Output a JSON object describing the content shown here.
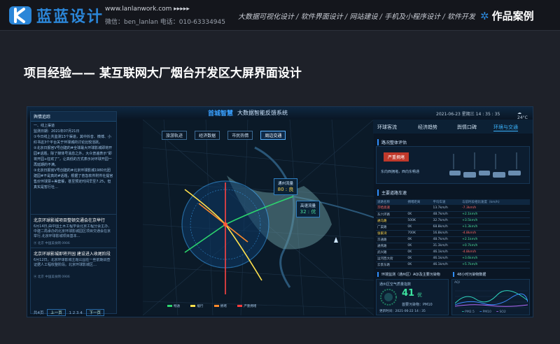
{
  "header": {
    "brand_name": "蓝蓝设计",
    "website": "www.lanlanwork.com  ▸▸▸▸▸",
    "contact": "微信：ben_lanlan    电话：010-63334945",
    "services": "大数据可视化设计 / 软件界面设计 / 网站建设 / 手机及小程序设计 / 软件开发",
    "works_label": "作品案例",
    "brand_color": "#2b86d8"
  },
  "page": {
    "heading": "项目经验—— 某互联网大厂烟台开发区大屏界面设计"
  },
  "screen": {
    "logo_text": "首城智慧",
    "title": "大数据智能反馈系统",
    "date": "2021-06-23  星期三    14 : 35 : 35",
    "temperature": "24°C",
    "left_panel": {
      "header": "舆情追踪",
      "body": "一、线上渠道\n监测日期：2021年07月21日\n①今日线上共监测13个渠道，其中抖音、微博、小红书这3个平台关于环球城的讨论比较活跃。\n②北京日报官V号创建的#全球最大环球影城即将开园#话题，除了媒体号消息之外，大众普遍表示“即将开园+狂欢了”，让高低的方式表示对环球开园一再延期的不满。\n③北京日报官V号创建的#北京环球影城1980元团建园#不是真的#话题，根据了普急软件附件社提官售价环球票+美套餐，甚至预定时间早至7.25，但真实是暂行社…",
      "news": [
        {
          "title": "北京环球影城项目整顿交通会在京举行",
          "body": "6月14日,由中国土木工程学会北京工程分会主办、中建二局承办的北京环球影城园区项目交通会在京举行,北京环球影城项目基本…",
          "footer": "⦿ 北京                    中国美食网  0906"
        },
        {
          "title": "北京环球影城即将开园 建设进入收尾阶段",
          "body": "6月12日，北京环球影城主题公园在一些前期调查证据人工程收整阶段。北京环球影城区…",
          "footer": "⦿ 北京                    中国美食网  0906"
        }
      ],
      "pager": {
        "prefix": "共4页",
        "prev": "上一页",
        "pages": "1  2  3  4",
        "next": "下一页"
      }
    },
    "filters": [
      "旅游轨迹",
      "经济数据",
      "市民热情",
      "周边交通"
    ],
    "map_labels": [
      {
        "title": "通州流量",
        "value": "80 : 良"
      },
      {
        "title": "高速流量",
        "value": "32 : 优"
      }
    ],
    "legend": [
      "畅通",
      "缓行",
      "拥堵",
      "严重拥堵"
    ],
    "right_panel": {
      "tabs": [
        "环球客流",
        "经济趋势",
        "舆情口碑",
        "环境与交通"
      ],
      "congestion_header": "路况整体评估",
      "congestion_status": "严重拥堵",
      "congestion_note": "东向西拥堵，西向东畅通",
      "roads_header": "主要道路车速",
      "table_headers": [
        "道路名称",
        "拥堵距离",
        "平均车速",
        "与前时段相比速度（km/h）"
      ],
      "table_rows": [
        [
          "京哈高速",
          "",
          "13.7km/h",
          "-7.3km/h"
        ],
        [
          "东六环路",
          "0K",
          "48.7km/h",
          "+2.1km/h"
        ],
        [
          "通马路",
          "500K",
          "32.7km/h",
          "+3.5km/h"
        ],
        [
          "广渠路",
          "0K",
          "68.8km/h",
          "+1.3km/h"
        ],
        [
          "张家湾",
          "700K",
          "16.8km/h",
          "-4.8km/h"
        ],
        [
          "京通路",
          "0K",
          "48.7km/h",
          "+2.1km/h"
        ],
        [
          "通燕路",
          "0K",
          "31.3km/h",
          "+0.7km/h"
        ],
        [
          "武兴路",
          "0K",
          "46.1km/h",
          "-4.8km/h"
        ],
        [
          "运河西大街",
          "0K",
          "46.1km/h",
          "+3.6km/h"
        ],
        [
          "云景东路",
          "0K",
          "46.1km/h",
          "+5.7km/h"
        ]
      ],
      "env_header": "环境监测（通州区）AQI及主要污染物",
      "aqi_caption": "通州区空气质量指数",
      "aqi_value": "41",
      "aqi_level": "优",
      "pollutant": "首要污染物：PM10",
      "updated": "更新时间：2021-06-22 14 : 35",
      "trend_header": "48小时污染物数据",
      "trend_axis": "AQI",
      "trend_legend": [
        "PM2.5",
        "PM10",
        "SO2"
      ]
    }
  }
}
